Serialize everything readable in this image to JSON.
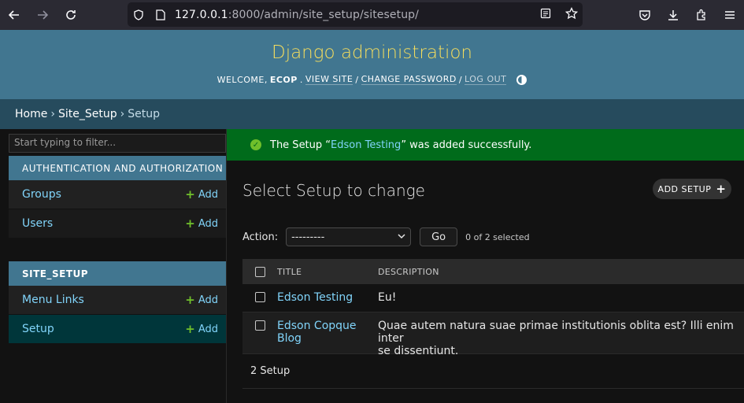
{
  "browser": {
    "url_host": "127.0.0.1",
    "url_rest": ":8000/admin/site_setup/sitesetup/"
  },
  "header": {
    "branding": "Django administration",
    "welcome": "WELCOME,",
    "username": "ECOP",
    "view_site": "VIEW SITE",
    "change_password": "CHANGE PASSWORD",
    "log_out": "LOG OUT",
    "sep": "/"
  },
  "breadcrumbs": {
    "home": "Home",
    "app": "Site_Setup",
    "current": "Setup",
    "sep": "›"
  },
  "sidebar": {
    "filter_placeholder": "Start typing to filter...",
    "modules": [
      {
        "caption": "AUTHENTICATION AND AUTHORIZATION",
        "items": [
          {
            "label": "Groups",
            "add": "Add"
          },
          {
            "label": "Users",
            "add": "Add"
          }
        ]
      },
      {
        "caption": "SITE_SETUP",
        "items": [
          {
            "label": "Menu Links",
            "add": "Add"
          },
          {
            "label": "Setup",
            "add": "Add"
          }
        ]
      }
    ]
  },
  "message": {
    "prefix": "The Setup “",
    "link": "Edson Testing",
    "suffix": "” was added successfully."
  },
  "main": {
    "title": "Select Setup to change",
    "add_button": "ADD SETUP",
    "action_label": "Action:",
    "action_selected": "---------",
    "go": "Go",
    "selected_count": "0 of 2 selected",
    "columns": {
      "title": "TITLE",
      "description": "DESCRIPTION"
    },
    "rows": [
      {
        "title": "Edson Testing",
        "description": "Eu!"
      },
      {
        "title_line1": "Edson Copque",
        "title_line2": "Blog",
        "desc_line1": "Quae autem natura suae primae institutionis oblita est? Illi enim inter",
        "desc_line2": "se dissentiunt."
      }
    ],
    "paginator": "2 Setup"
  },
  "colors": {
    "header_bg": "#417690",
    "branding": "#f5dd5d",
    "breadcrumb_bg": "#264b5d",
    "success_bg": "#006b1b",
    "link": "#81d4fa",
    "add_plus": "#70bf2b"
  }
}
